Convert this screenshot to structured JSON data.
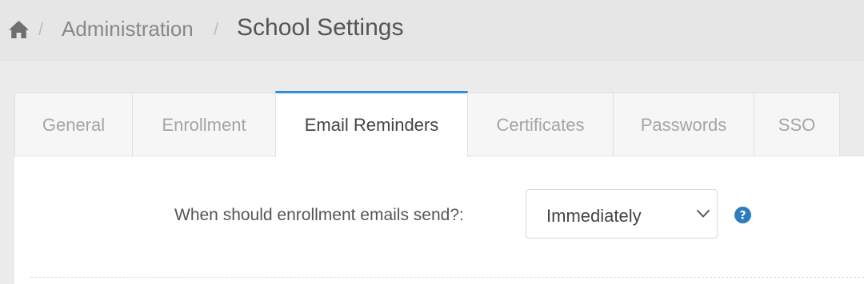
{
  "breadcrumb": {
    "home_icon": "home-icon",
    "separator": "/",
    "items": [
      "Administration"
    ],
    "current": "School Settings"
  },
  "tabs": [
    {
      "label": "General",
      "active": false
    },
    {
      "label": "Enrollment",
      "active": false
    },
    {
      "label": "Email Reminders",
      "active": true
    },
    {
      "label": "Certificates",
      "active": false
    },
    {
      "label": "Passwords",
      "active": false
    },
    {
      "label": "SSO",
      "active": false
    }
  ],
  "form": {
    "enrollment_emails_label": "When should enrollment emails send?:",
    "enrollment_emails_value": "Immediately",
    "help_icon": "question-circle-icon"
  },
  "colors": {
    "accent": "#2e8fd6",
    "help": "#2f7bbf"
  }
}
